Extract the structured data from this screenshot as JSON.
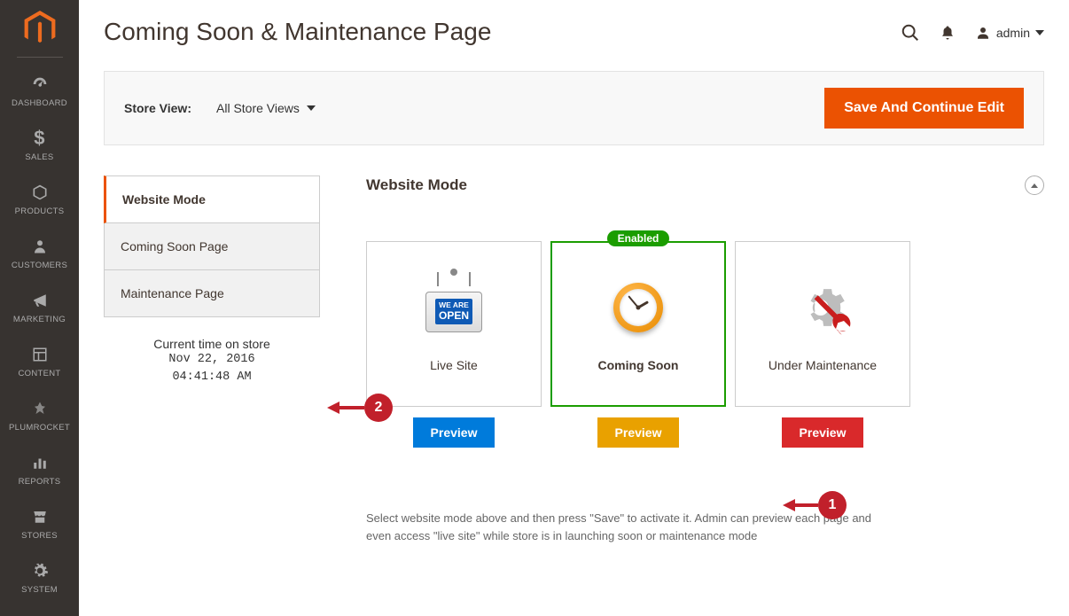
{
  "page_title": "Coming Soon & Maintenance Page",
  "header": {
    "user_label": "admin"
  },
  "storebar": {
    "label": "Store View:",
    "value": "All Store Views",
    "save_btn": "Save And Continue Edit"
  },
  "tabs": {
    "items": [
      {
        "label": "Website Mode",
        "id": "website-mode"
      },
      {
        "label": "Coming Soon Page",
        "id": "coming-soon-page"
      },
      {
        "label": "Maintenance Page",
        "id": "maintenance-page"
      }
    ],
    "footer": {
      "title": "Current time on store",
      "date": "Nov 22, 2016",
      "time": "04:41:48 AM"
    }
  },
  "section": {
    "title": "Website Mode",
    "enabled_badge": "Enabled",
    "modes": [
      {
        "label": "Live Site",
        "preview": "Preview"
      },
      {
        "label": "Coming Soon",
        "preview": "Preview"
      },
      {
        "label": "Under Maintenance",
        "preview": "Preview"
      }
    ],
    "help": "Select website mode above and then press \"Save\" to activate it. Admin can preview each page and even access \"live site\" while store is in launching soon or maintenance mode"
  },
  "sign_text": {
    "line1": "WE ARE",
    "line2": "OPEN"
  },
  "nav": [
    {
      "label": "Dashboard"
    },
    {
      "label": "Sales"
    },
    {
      "label": "Products"
    },
    {
      "label": "Customers"
    },
    {
      "label": "Marketing"
    },
    {
      "label": "Content"
    },
    {
      "label": "Plumrocket"
    },
    {
      "label": "Reports"
    },
    {
      "label": "Stores"
    },
    {
      "label": "System"
    }
  ],
  "markers": {
    "m1": "1",
    "m2": "2"
  }
}
